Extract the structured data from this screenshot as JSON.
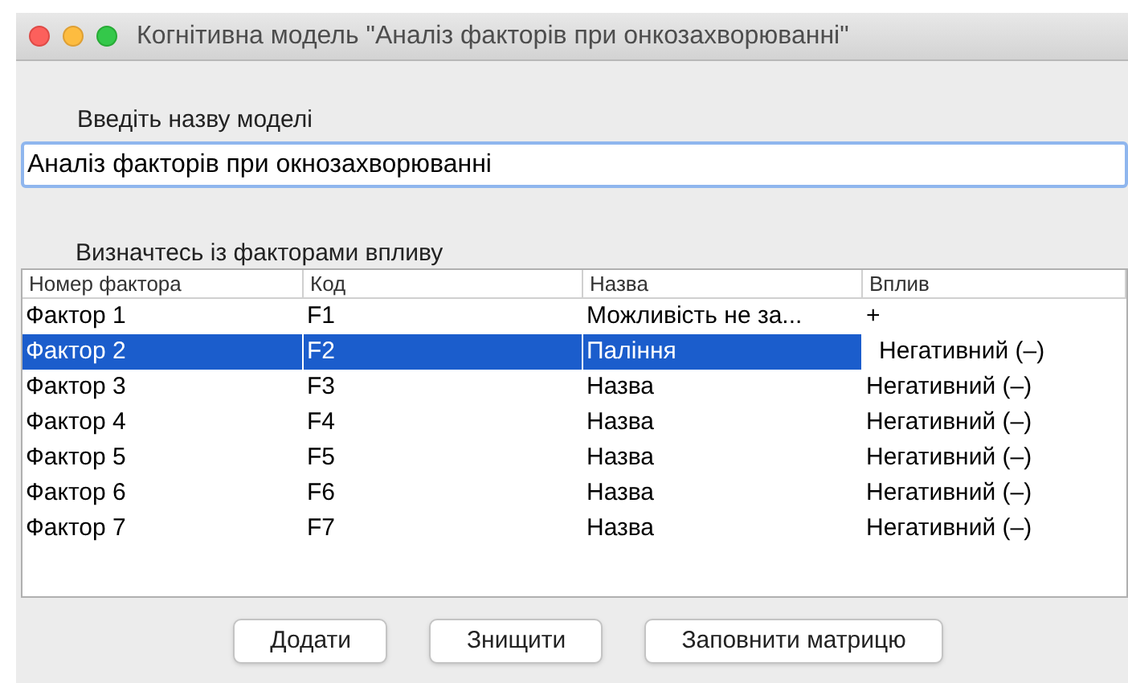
{
  "window": {
    "title": "Когнітивна модель \"Аналіз факторів при онкозахворюванні\""
  },
  "name_label": "Введіть назву моделі",
  "name_field": {
    "value": "Аналіз факторів при окнозахворюванні"
  },
  "table_label": "Визначтесь із факторами впливу",
  "table": {
    "columns": [
      "Номер фактора",
      "Код",
      "Назва",
      "Вплив"
    ],
    "rows": [
      {
        "cells": [
          "Фактор 1",
          "F1",
          "Можливість  не за...",
          "+"
        ],
        "selected": false,
        "editing": false
      },
      {
        "cells": [
          "Фактор 2",
          "F2",
          "Паління",
          "Негативний (–)"
        ],
        "selected": true,
        "editing": true
      },
      {
        "cells": [
          "Фактор 3",
          "F3",
          "Назва",
          "Негативний (–)"
        ],
        "selected": false,
        "editing": false
      },
      {
        "cells": [
          "Фактор 4",
          "F4",
          "Назва",
          "Негативний (–)"
        ],
        "selected": false,
        "editing": false
      },
      {
        "cells": [
          "Фактор 5",
          "F5",
          "Назва",
          "Негативний (–)"
        ],
        "selected": false,
        "editing": false
      },
      {
        "cells": [
          "Фактор 6",
          "F6",
          "Назва",
          "Негативний (–)"
        ],
        "selected": false,
        "editing": false
      },
      {
        "cells": [
          "Фактор 7",
          "F7",
          "Назва",
          "Негативний (–)"
        ],
        "selected": false,
        "editing": false
      }
    ]
  },
  "buttons": [
    "Додати",
    "Знищити",
    "Заповнити матрицю"
  ]
}
